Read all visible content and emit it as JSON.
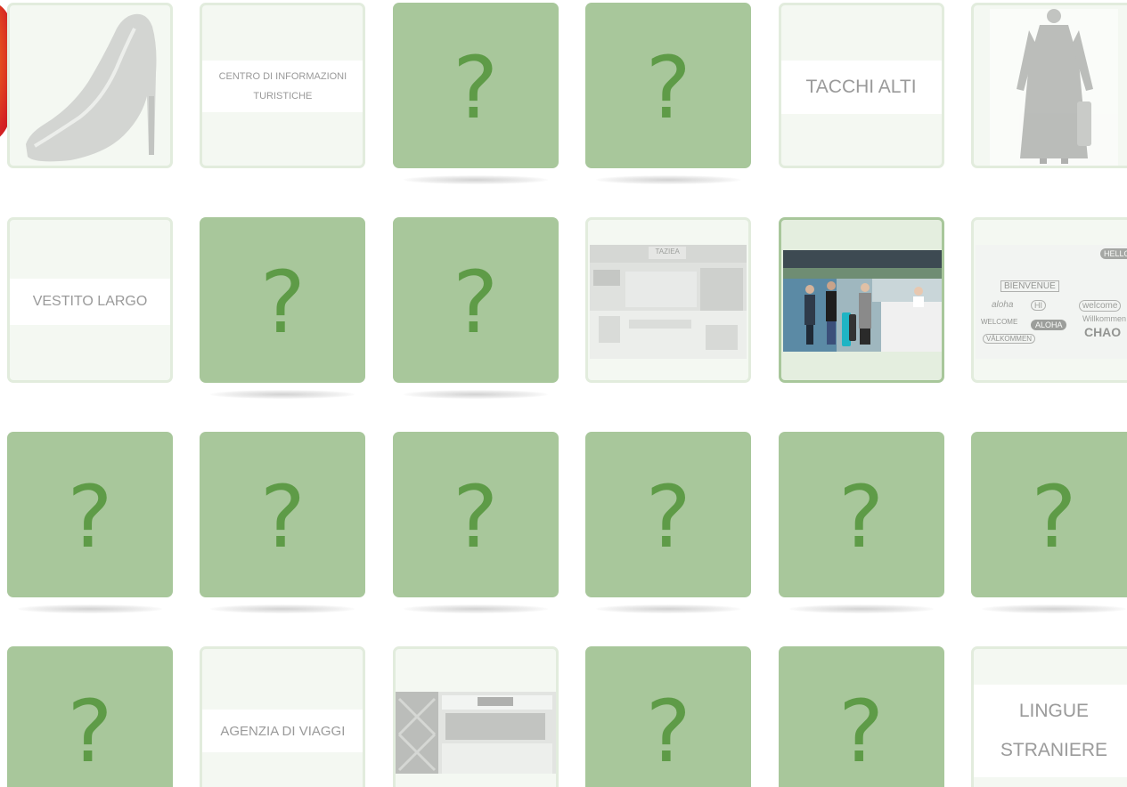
{
  "game": {
    "hidden_symbol": "?",
    "cards": [
      {
        "row": 1,
        "col": 1,
        "state": "revealed",
        "kind": "image",
        "subject": "high-heel-shoe"
      },
      {
        "row": 1,
        "col": 2,
        "state": "revealed",
        "kind": "text",
        "label": "CENTRO DI INFORMAZIONI TURISTICHE"
      },
      {
        "row": 1,
        "col": 3,
        "state": "hidden"
      },
      {
        "row": 1,
        "col": 4,
        "state": "hidden"
      },
      {
        "row": 1,
        "col": 5,
        "state": "revealed",
        "kind": "text",
        "label": "TACCHI ALTI"
      },
      {
        "row": 1,
        "col": 6,
        "state": "revealed",
        "kind": "image",
        "subject": "long-dress"
      },
      {
        "row": 2,
        "col": 1,
        "state": "revealed",
        "kind": "text",
        "label": "VESTITO LARGO"
      },
      {
        "row": 2,
        "col": 2,
        "state": "hidden"
      },
      {
        "row": 2,
        "col": 3,
        "state": "hidden"
      },
      {
        "row": 2,
        "col": 4,
        "state": "revealed",
        "kind": "image",
        "subject": "shop-counter"
      },
      {
        "row": 2,
        "col": 5,
        "state": "revealed",
        "kind": "image",
        "subject": "hotel-reception",
        "active": true
      },
      {
        "row": 2,
        "col": 6,
        "state": "revealed",
        "kind": "image",
        "subject": "greetings-words"
      },
      {
        "row": 3,
        "col": 1,
        "state": "hidden"
      },
      {
        "row": 3,
        "col": 2,
        "state": "hidden"
      },
      {
        "row": 3,
        "col": 3,
        "state": "hidden"
      },
      {
        "row": 3,
        "col": 4,
        "state": "hidden"
      },
      {
        "row": 3,
        "col": 5,
        "state": "hidden"
      },
      {
        "row": 3,
        "col": 6,
        "state": "hidden"
      },
      {
        "row": 4,
        "col": 1,
        "state": "hidden"
      },
      {
        "row": 4,
        "col": 2,
        "state": "revealed",
        "kind": "text",
        "label": "AGENZIA DI VIAGGI"
      },
      {
        "row": 4,
        "col": 3,
        "state": "revealed",
        "kind": "image",
        "subject": "travel-agency-storefront"
      },
      {
        "row": 4,
        "col": 4,
        "state": "hidden"
      },
      {
        "row": 4,
        "col": 5,
        "state": "hidden"
      },
      {
        "row": 4,
        "col": 6,
        "state": "revealed",
        "kind": "text",
        "label_lines": [
          "LINGUE",
          "STRANIERE"
        ]
      }
    ],
    "image_texts": {
      "shop_sign": "TAZIEA",
      "greetings": [
        "HELLO",
        "BIENVENUE",
        "aloha",
        "HI",
        "welcome",
        "WELCOME",
        "ALOHA",
        "CHAO",
        "Willkommen",
        "VÄLKOMMEN",
        "hola",
        "ciao"
      ]
    }
  },
  "colors": {
    "hidden_card": "#a8c79b",
    "question_mark": "#5e9b47",
    "revealed_border": "#e2ecdd",
    "revealed_bg": "#f4f8f2",
    "label_text": "#9a9a9a"
  }
}
